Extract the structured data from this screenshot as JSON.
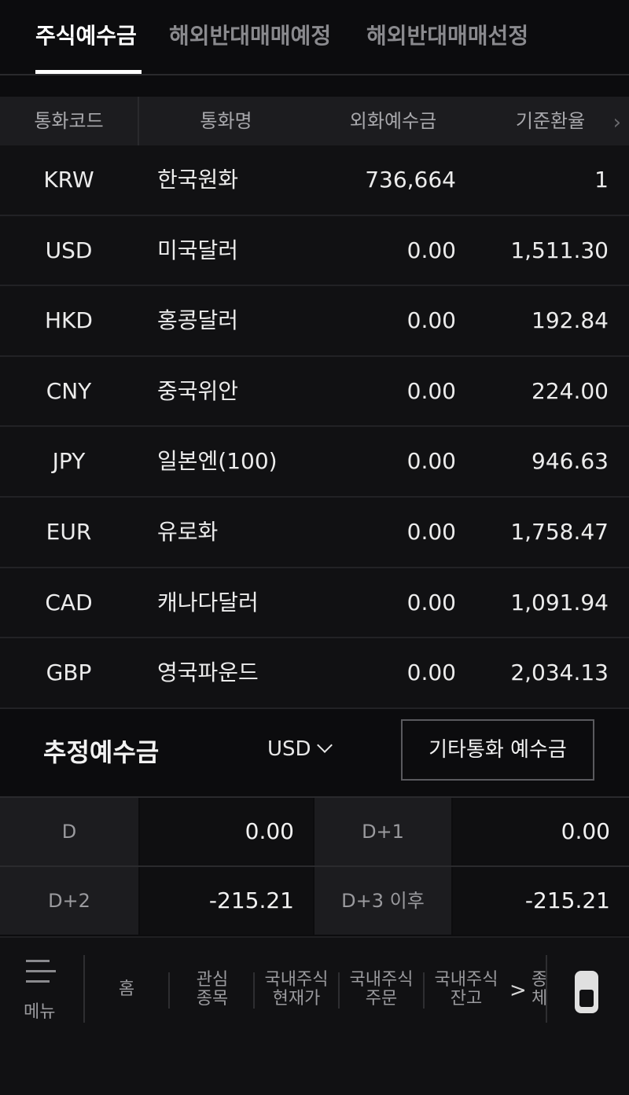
{
  "tabs": [
    {
      "label": "주식예수금",
      "active": true
    },
    {
      "label": "해외반대매매예정",
      "active": false
    },
    {
      "label": "해외반대매매선정",
      "active": false
    }
  ],
  "table": {
    "headers": [
      "통화코드",
      "통화명",
      "외화예수금",
      "기준환율"
    ],
    "rows": [
      {
        "code": "KRW",
        "name": "한국원화",
        "balance": "736,664",
        "rate": "1"
      },
      {
        "code": "USD",
        "name": "미국달러",
        "balance": "0.00",
        "rate": "1,511.30"
      },
      {
        "code": "HKD",
        "name": "홍콩달러",
        "balance": "0.00",
        "rate": "192.84"
      },
      {
        "code": "CNY",
        "name": "중국위안",
        "balance": "0.00",
        "rate": "224.00"
      },
      {
        "code": "JPY",
        "name": "일본엔(100)",
        "balance": "0.00",
        "rate": "946.63"
      },
      {
        "code": "EUR",
        "name": "유로화",
        "balance": "0.00",
        "rate": "1,758.47"
      },
      {
        "code": "CAD",
        "name": "캐나다달러",
        "balance": "0.00",
        "rate": "1,091.94"
      },
      {
        "code": "GBP",
        "name": "영국파운드",
        "balance": "0.00",
        "rate": "2,034.13"
      }
    ]
  },
  "estimated": {
    "title": "추정예수금",
    "currency": "USD",
    "other_button": "기타통화 예수금",
    "cells": [
      {
        "label": "D",
        "value": "0.00"
      },
      {
        "label": "D+1",
        "value": "0.00"
      },
      {
        "label": "D+2",
        "value": "-215.21"
      },
      {
        "label": "D+3 이후",
        "value": "-215.21"
      }
    ]
  },
  "bottom_nav": {
    "menu_label": "메뉴",
    "items": [
      "홈",
      "관심\n종목",
      "국내주식\n현재가",
      "국내주식\n주문",
      "국내주식\n잔고"
    ],
    "more_arrow": ">",
    "clipped_item": "종\n체"
  },
  "icons": {
    "header_scroll": "chevron-right-icon",
    "menu": "hamburger-menu-icon",
    "currency_dropdown": "chevron-down-icon",
    "scroll_toggle": "scroll-toggle-icon"
  },
  "colors": {
    "background": "#0c0c0e",
    "header_bg": "#1c1c1f",
    "text_primary": "#ececec",
    "text_muted": "#9a9a9e"
  }
}
